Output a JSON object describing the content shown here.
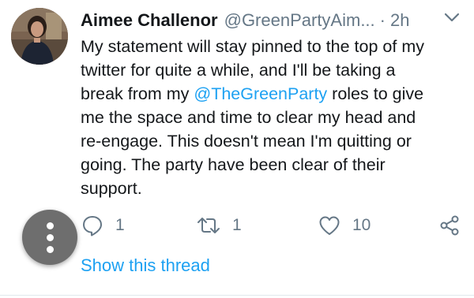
{
  "tweet": {
    "author_name": "Aimee Challenor",
    "handle": "@GreenPartyAim...",
    "separator": "·",
    "time": "2h",
    "text_lines": [
      [
        "My statement will stay pinned to the top of my"
      ],
      [
        "twitter for quite a while, and I'll be taking a"
      ],
      [
        "break from my ",
        "@TheGreenParty",
        " roles to give"
      ],
      [
        "me the space and time to clear my head and"
      ],
      [
        "re-engage. This doesn't mean I'm quitting or"
      ],
      [
        "going. The party have been clear of their"
      ],
      [
        "support."
      ]
    ],
    "mention": "@TheGreenParty",
    "replies": "1",
    "retweets": "1",
    "likes": "10",
    "show_thread": "Show this thread"
  },
  "icons": {
    "reply": "reply-icon",
    "retweet": "retweet-icon",
    "like": "heart-icon",
    "share": "share-icon",
    "caret": "chevron-down-icon",
    "fab": "more-vertical-icon"
  },
  "colors": {
    "accent": "#1da1f2",
    "secondary_text": "#657786",
    "primary_text": "#14171a"
  }
}
